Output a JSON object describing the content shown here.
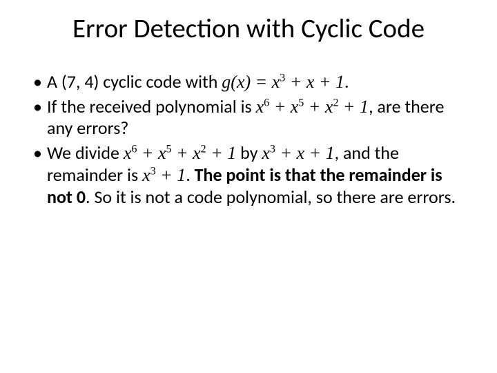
{
  "title": "Error Detection with Cyclic Code",
  "bullets": {
    "b1": {
      "t1": "A (7, 4) cyclic code with ",
      "gx": "g(x) = x",
      "p3": "3",
      "t2": " + x + 1",
      "t3": "."
    },
    "b2": {
      "t1": "If the received polynomial is ",
      "x": "x",
      "p6": "6",
      "plus": " + ",
      "p5": "5",
      "p2": "2",
      "plus1": " + 1",
      "t2": ", are there any errors?"
    },
    "b3": {
      "t1": "We divide ",
      "x": "x",
      "p6": "6",
      "plus": " + ",
      "p5": "5",
      "p2": "2",
      "plus1": " + 1",
      "by": " by ",
      "p3": "3",
      "xp1": " + x + 1",
      "t2": ", and the remainder is ",
      "t3": ". ",
      "bold1": "The point is that the remainder is not 0",
      "t4": ". So it is not a code polynomial, so there are errors."
    }
  },
  "dot": "•"
}
